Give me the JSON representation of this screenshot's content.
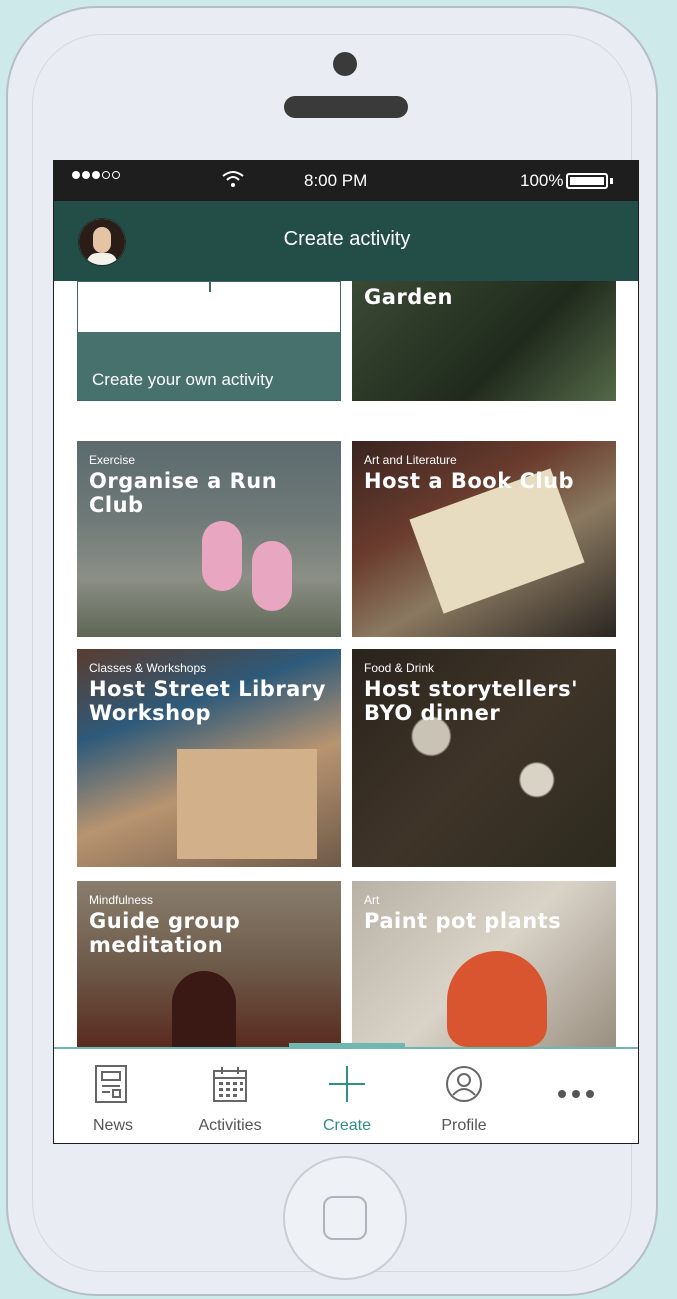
{
  "status_bar": {
    "time": "8:00 PM",
    "battery": "100%",
    "signal_dots": [
      "full",
      "full",
      "full",
      "empty",
      "empty"
    ]
  },
  "header": {
    "title": "Create activity"
  },
  "tiles": [
    {
      "id": "own",
      "category": "",
      "title": "Create your own activity"
    },
    {
      "id": "garden",
      "category": "",
      "title": "Garden"
    },
    {
      "id": "run",
      "category": "Exercise",
      "title": "Organise a Run Club"
    },
    {
      "id": "book",
      "category": "Art and Literature",
      "title": "Host a Book Club"
    },
    {
      "id": "library",
      "category": "Classes & Workshops",
      "title": "Host Street Library Workshop"
    },
    {
      "id": "dinner",
      "category": "Food & Drink",
      "title": "Host storytellers' BYO dinner"
    },
    {
      "id": "meditation",
      "category": "Mindfulness",
      "title": "Guide group meditation"
    },
    {
      "id": "paint",
      "category": "Art",
      "title": "Paint pot plants"
    }
  ],
  "tabbar": {
    "items": [
      {
        "label": "News",
        "icon": "newspaper-icon"
      },
      {
        "label": "Activities",
        "icon": "calendar-icon"
      },
      {
        "label": "Create",
        "icon": "plus-icon",
        "active": true
      },
      {
        "label": "Profile",
        "icon": "user-circle-icon"
      },
      {
        "label": "",
        "icon": "more-icon"
      }
    ]
  },
  "colors": {
    "header": "#234e48",
    "accent": "#2e8f83",
    "tab_indicator": "#6fb8b0",
    "background": "#cde9ea"
  }
}
